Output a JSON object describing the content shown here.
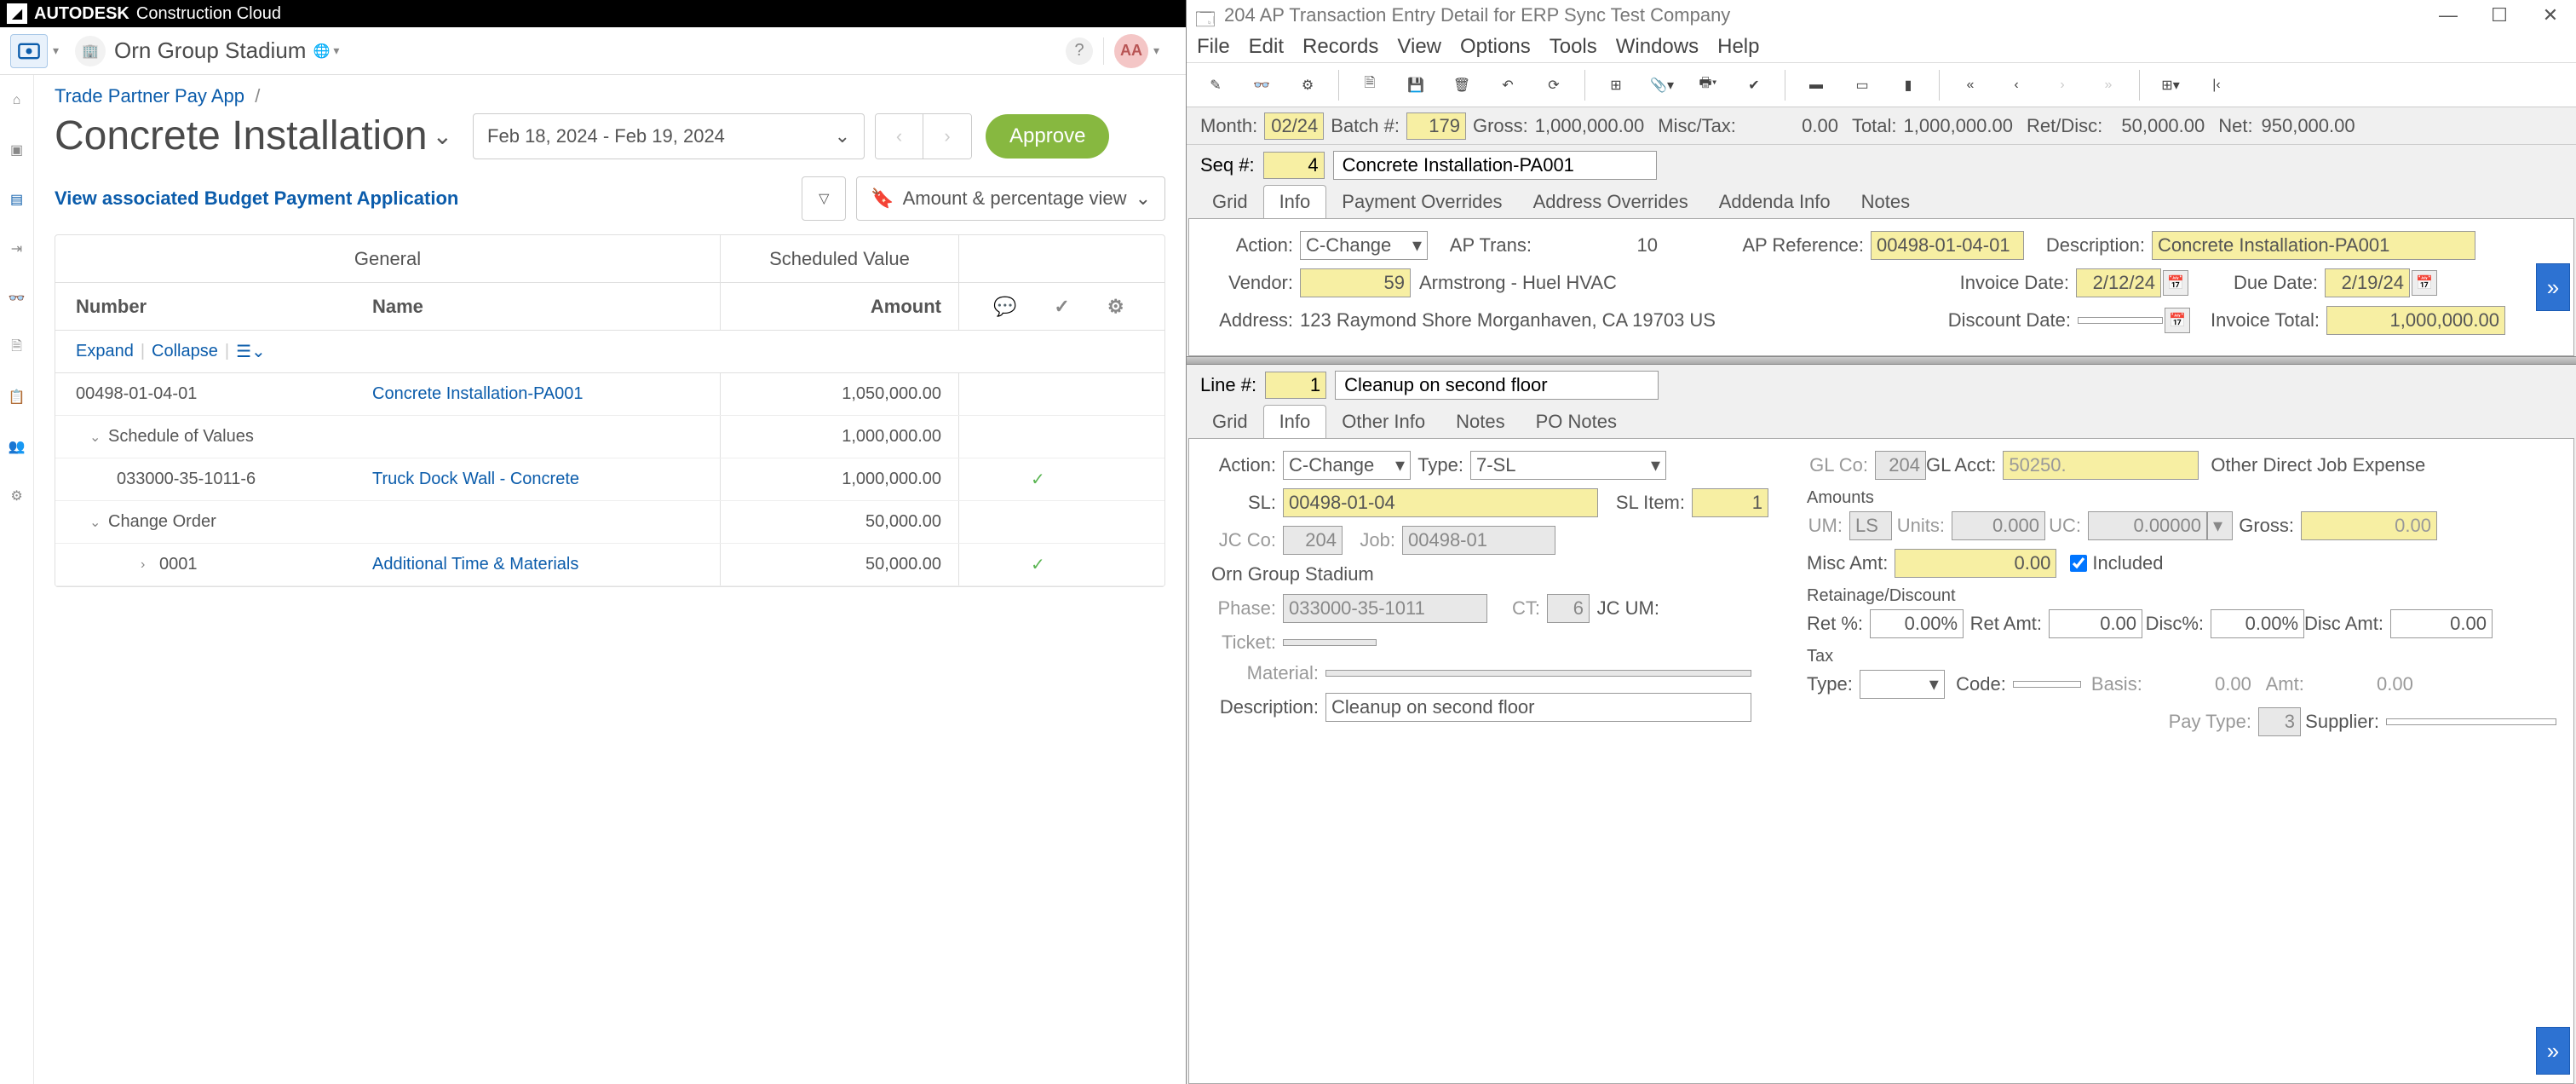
{
  "autodesk": {
    "brand": "AUTODESK",
    "product": "Construction Cloud",
    "project": "Orn Group Stadium",
    "avatar": "AA",
    "breadcrumb_link": "Trade Partner Pay App",
    "page_title": "Concrete Installation",
    "date_range": "Feb 18, 2024 - Feb 19, 2024",
    "approve_btn": "Approve",
    "assoc_link": "View associated Budget Payment Application",
    "view_label": "Amount & percentage view",
    "grid": {
      "group_general": "General",
      "group_sched": "Scheduled Value",
      "col_number": "Number",
      "col_name": "Name",
      "col_amount": "Amount",
      "expand": "Expand",
      "collapse": "Collapse",
      "rows": [
        {
          "num": "00498-01-04-01",
          "name": "Concrete Installation-PA001",
          "amt": "1,050,000.00",
          "link": true
        },
        {
          "num": "Schedule of Values",
          "amt": "1,000,000.00",
          "caret": true,
          "indent": 1
        },
        {
          "num": "033000-35-1011-6",
          "name": "Truck Dock Wall - Concrete",
          "amt": "1,000,000.00",
          "link": true,
          "indent": 2,
          "check": true
        },
        {
          "num": "Change Order",
          "amt": "50,000.00",
          "caret": true,
          "indent": 1
        },
        {
          "num": "0001",
          "name": "Additional Time & Materials",
          "amt": "50,000.00",
          "link": true,
          "indent": 3,
          "caret_right": true,
          "check": true
        }
      ]
    }
  },
  "erp": {
    "window_title": "204 AP Transaction Entry Detail for ERP Sync Test Company",
    "menus": [
      "File",
      "Edit",
      "Records",
      "View",
      "Options",
      "Tools",
      "Windows",
      "Help"
    ],
    "info": {
      "month_lbl": "Month:",
      "month": "02/24",
      "batch_lbl": "Batch #:",
      "batch": "179",
      "gross_lbl": "Gross:",
      "gross": "1,000,000.00",
      "misc_lbl": "Misc/Tax:",
      "misc": "0.00",
      "total_lbl": "Total:",
      "total": "1,000,000.00",
      "ret_lbl": "Ret/Disc:",
      "ret": "50,000.00",
      "net_lbl": "Net:",
      "net": "950,000.00"
    },
    "seq_lbl": "Seq #:",
    "seq": "4",
    "seq_desc": "Concrete Installation-PA001",
    "upper_tabs": [
      "Grid",
      "Info",
      "Payment Overrides",
      "Address Overrides",
      "Addenda Info",
      "Notes"
    ],
    "upper_active": 1,
    "upper": {
      "action_lbl": "Action:",
      "action": "C-Change",
      "aptrans_lbl": "AP Trans:",
      "aptrans": "10",
      "apref_lbl": "AP Reference:",
      "apref": "00498-01-04-01",
      "desc_lbl": "Description:",
      "desc": "Concrete Installation-PA001",
      "vendor_lbl": "Vendor:",
      "vendor": "59",
      "vendor_name": "Armstrong - Huel HVAC",
      "invdate_lbl": "Invoice Date:",
      "invdate": "2/12/24",
      "duedate_lbl": "Due Date:",
      "duedate": "2/19/24",
      "addr_lbl": "Address:",
      "addr": "123 Raymond Shore  Morganhaven, CA  19703  US",
      "discdate_lbl": "Discount Date:",
      "discdate": "",
      "invtot_lbl": "Invoice Total:",
      "invtot": "1,000,000.00"
    },
    "line_lbl": "Line #:",
    "line": "1",
    "line_desc": "Cleanup on second floor",
    "lower_tabs": [
      "Grid",
      "Info",
      "Other Info",
      "Notes",
      "PO Notes"
    ],
    "lower_active": 1,
    "lower": {
      "action_lbl": "Action:",
      "action": "C-Change",
      "type_lbl": "Type:",
      "type": "7-SL",
      "glco_lbl": "GL Co:",
      "glco": "204",
      "glacct_lbl": "GL Acct:",
      "glacct": "50250.",
      "glacct_desc": "Other Direct Job Expense",
      "sl_lbl": "SL:",
      "sl": "00498-01-04",
      "slitem_lbl": "SL Item:",
      "slitem": "1",
      "jcco_lbl": "JC Co:",
      "jcco": "204",
      "job_lbl": "Job:",
      "job": "00498-01",
      "project": "Orn Group Stadium",
      "phase_lbl": "Phase:",
      "phase": "033000-35-1011",
      "ct_lbl": "CT:",
      "ct": "6",
      "jcum_lbl": "JC UM:",
      "ticket_lbl": "Ticket:",
      "material_lbl": "Material:",
      "desc_lbl": "Description:",
      "desc": "Cleanup on second floor",
      "amounts_title": "Amounts",
      "um_lbl": "UM:",
      "um": "LS",
      "units_lbl": "Units:",
      "units": "0.000",
      "uc_lbl": "UC:",
      "uc": "0.00000",
      "gross_lbl": "Gross:",
      "gross": "0.00",
      "misc_lbl": "Misc Amt:",
      "misc": "0.00",
      "included_lbl": "Included",
      "retd_title": "Retainage/Discount",
      "retpct_lbl": "Ret %:",
      "retpct": "0.00%",
      "retamt_lbl": "Ret Amt:",
      "retamt": "0.00",
      "discpct_lbl": "Disc%:",
      "discpct": "0.00%",
      "discamt_lbl": "Disc Amt:",
      "discamt": "0.00",
      "tax_title": "Tax",
      "taxtype_lbl": "Type:",
      "taxcode_lbl": "Code:",
      "basis_lbl": "Basis:",
      "basis": "0.00",
      "amt_lbl": "Amt:",
      "amt": "0.00",
      "paytype_lbl": "Pay Type:",
      "paytype": "3",
      "supplier_lbl": "Supplier:"
    }
  }
}
